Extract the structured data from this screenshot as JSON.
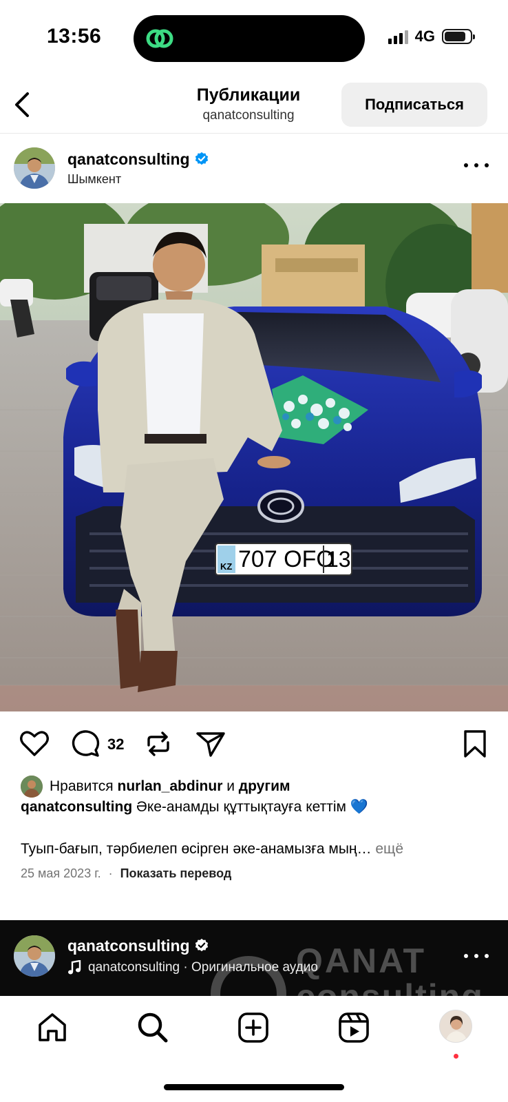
{
  "status_bar": {
    "time": "13:56",
    "network": "4G",
    "island_icon": "threads-icon",
    "island_icon_color": "#3ddc84"
  },
  "header": {
    "title": "Публикации",
    "subtitle": "qanatconsulting",
    "subscribe_label": "Подписаться",
    "back_icon": "chevron-left-icon"
  },
  "post": {
    "username": "qanatconsulting",
    "verified": true,
    "location": "Шымкент",
    "photo": {
      "license_plate_country": "KZ",
      "license_plate_number": "707 OFO",
      "license_plate_region": "13"
    },
    "comment_count": "32",
    "actions": [
      "heart-icon",
      "comment-icon",
      "repost-icon",
      "share-icon",
      "bookmark-icon"
    ],
    "likes": {
      "prefix": "Нравится",
      "user": "nurlan_abdinur",
      "joiner": "и",
      "others": "другим"
    },
    "caption": {
      "username": "qanatconsulting",
      "text": "Әке-анамды құттықтауға кеттім 💙",
      "body": "Туып-бағып, тәрбиелеп өсірген әке-анамызға мың…",
      "more": "ещё"
    },
    "date": "25 мая 2023 г.",
    "separator": "·",
    "translate_label": "Показать перевод"
  },
  "next_post": {
    "username": "qanatconsulting",
    "audio": "qanatconsulting · Оригинальное аудио",
    "watermark_line1": "QANAT",
    "watermark_line2": "consulting"
  },
  "tab_bar": {
    "tabs": [
      "home-icon",
      "search-icon",
      "create-icon",
      "reels-icon",
      "profile-avatar"
    ]
  },
  "colors": {
    "verified_blue": "#0095f6",
    "notification_red": "#ff3040",
    "car_blue": "#1b2a9c"
  }
}
